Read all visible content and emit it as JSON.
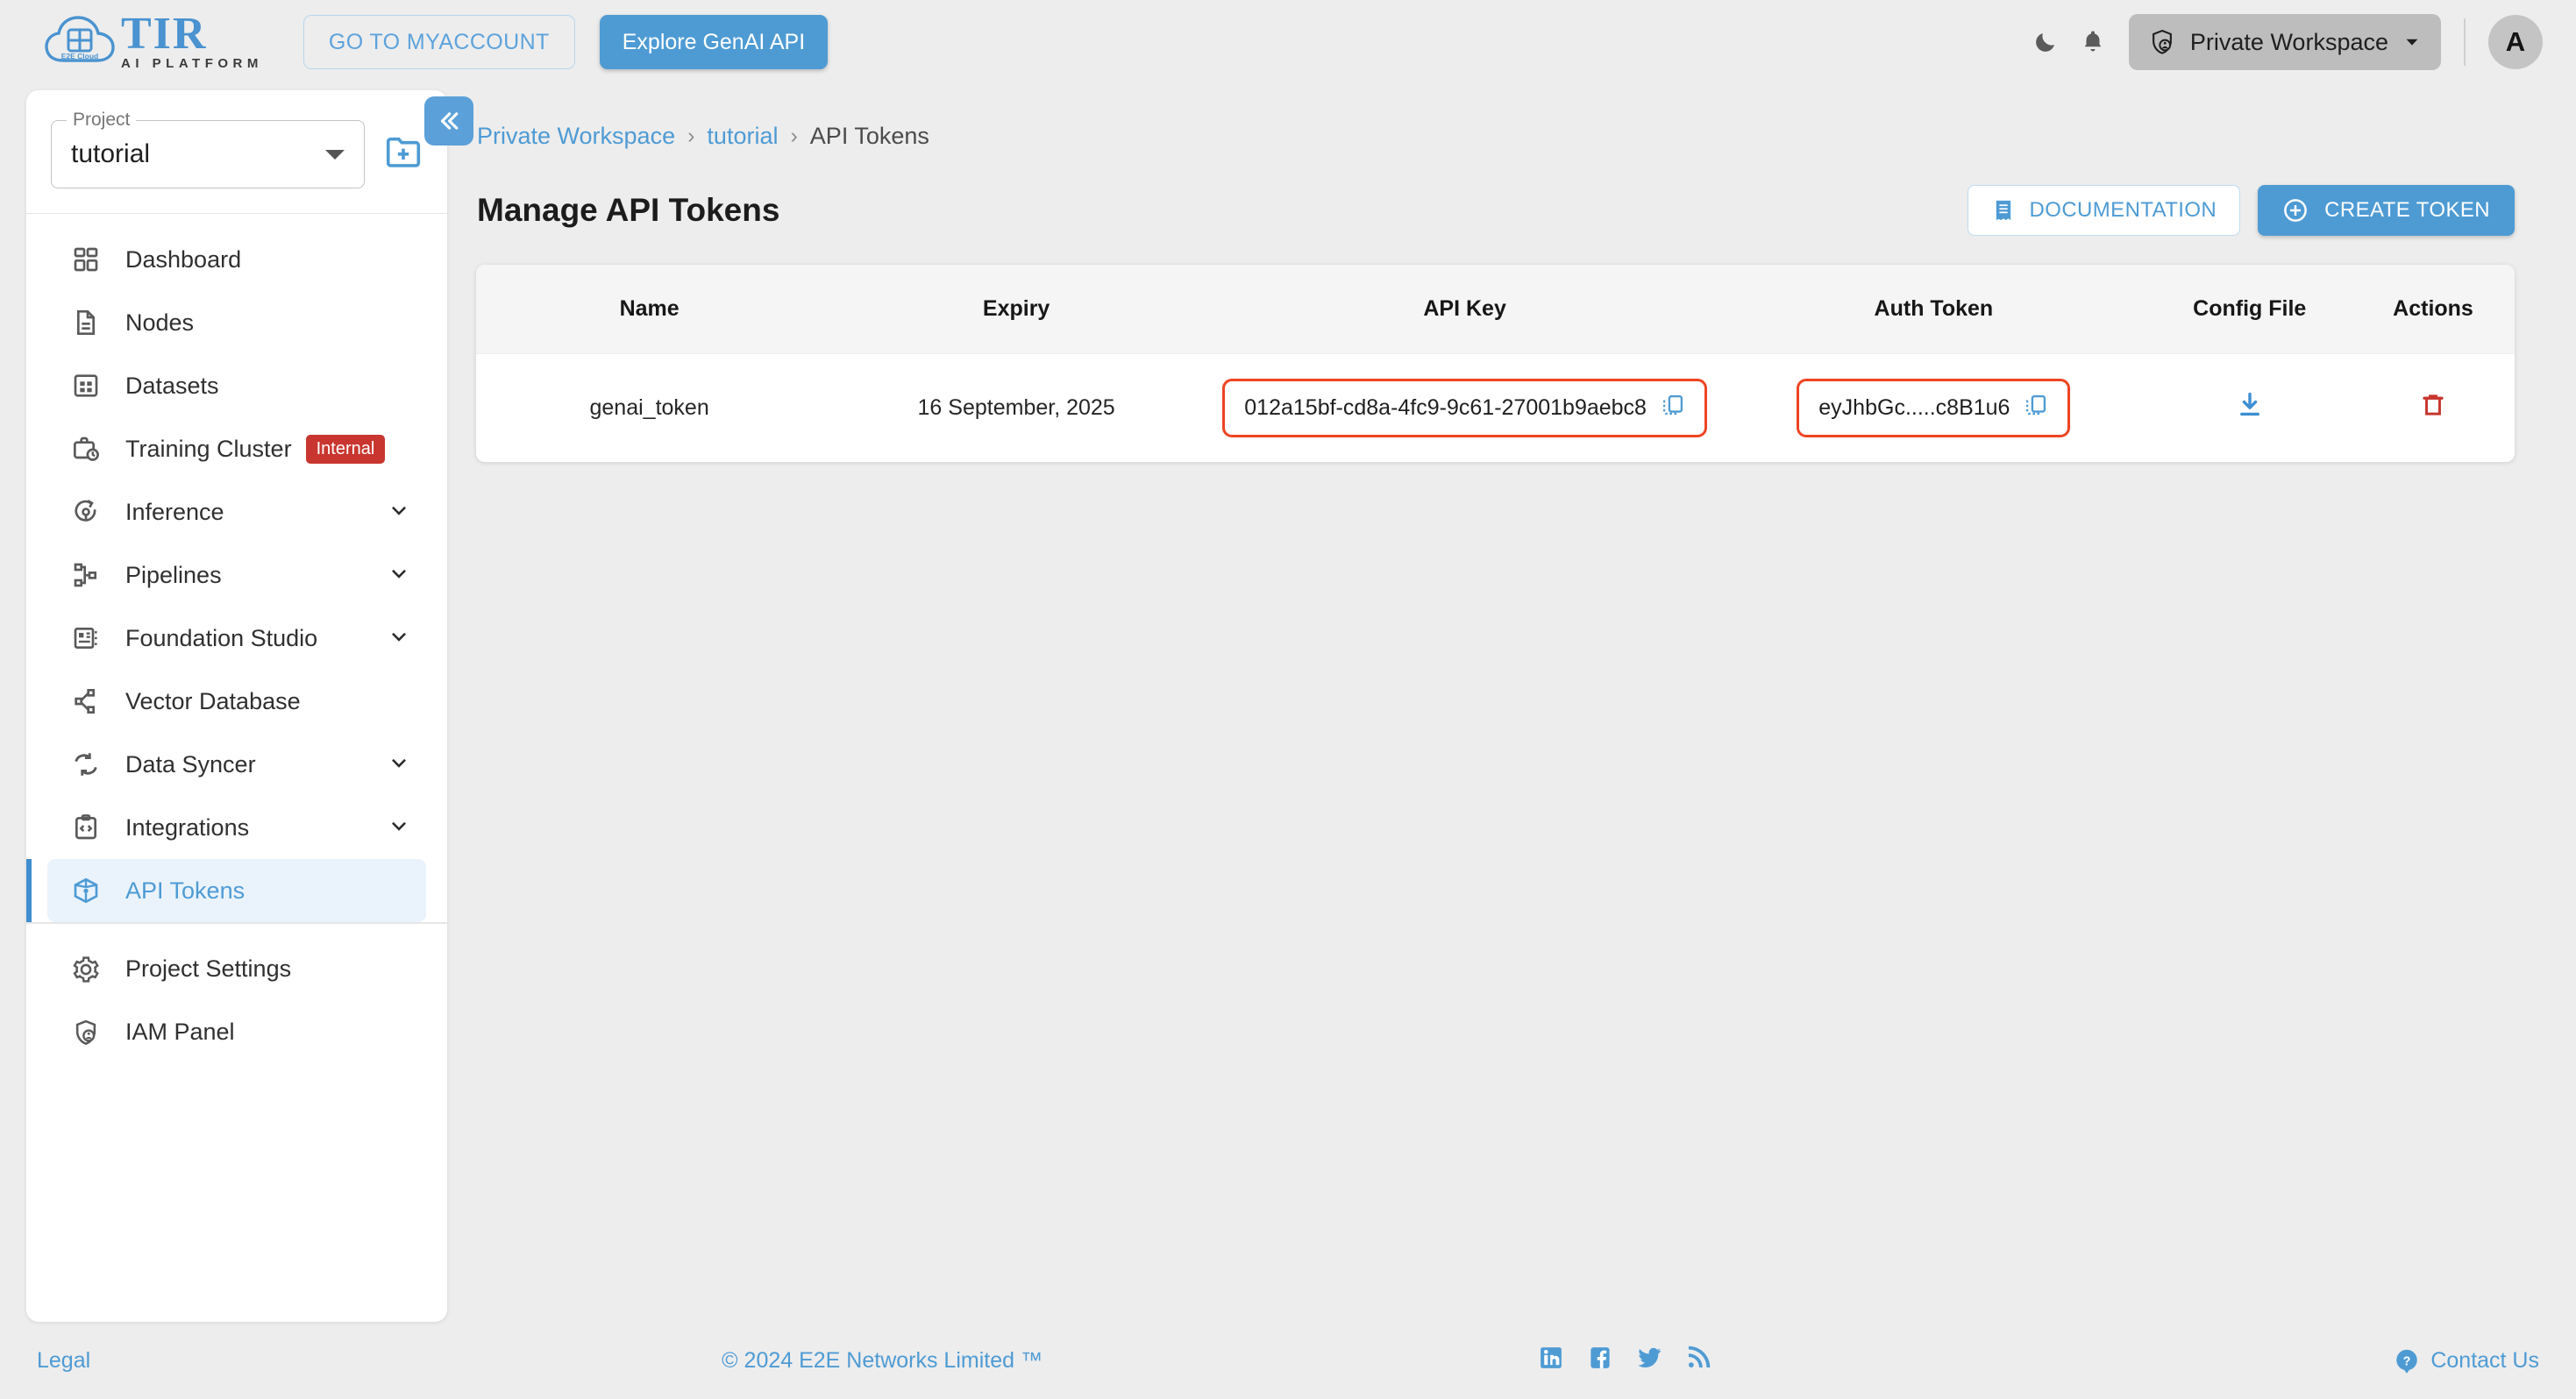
{
  "header": {
    "logo_title": "TIR",
    "logo_subtitle": "AI PLATFORM",
    "logo_cloud_text": "E2E Cloud",
    "myaccount_label": "GO TO MYACCOUNT",
    "genai_label": "Explore GenAI API",
    "dark_mode_icon": "moon-icon",
    "notification_icon": "bell-icon",
    "workspace_icon": "shield-user-icon",
    "workspace_label": "Private Workspace",
    "workspace_caret_icon": "chevron-down-icon",
    "avatar_initial": "A"
  },
  "sidebar": {
    "project_label": "Project",
    "project_value": "tutorial",
    "new_project_icon": "folder-plus-icon",
    "items": [
      {
        "label": "Dashboard",
        "icon": "dashboard-icon",
        "expandable": false,
        "badge": "",
        "active": false
      },
      {
        "label": "Nodes",
        "icon": "document-icon",
        "expandable": false,
        "badge": "",
        "active": false
      },
      {
        "label": "Datasets",
        "icon": "table-icon",
        "expandable": false,
        "badge": "",
        "active": false
      },
      {
        "label": "Training Cluster",
        "icon": "briefcase-clock-icon",
        "expandable": false,
        "badge": "Internal",
        "active": false
      },
      {
        "label": "Inference",
        "icon": "inference-icon",
        "expandable": true,
        "badge": "",
        "active": false
      },
      {
        "label": "Pipelines",
        "icon": "pipeline-icon",
        "expandable": true,
        "badge": "",
        "active": false
      },
      {
        "label": "Foundation Studio",
        "icon": "studio-icon",
        "expandable": true,
        "badge": "",
        "active": false
      },
      {
        "label": "Vector Database",
        "icon": "graph-node-icon",
        "expandable": false,
        "badge": "",
        "active": false
      },
      {
        "label": "Data Syncer",
        "icon": "sync-icon",
        "expandable": true,
        "badge": "",
        "active": false
      },
      {
        "label": "Integrations",
        "icon": "code-clipboard-icon",
        "expandable": true,
        "badge": "",
        "active": false
      },
      {
        "label": "API Tokens",
        "icon": "cube-icon",
        "expandable": false,
        "badge": "",
        "active": true
      }
    ],
    "bottom_items": [
      {
        "label": "Project Settings",
        "icon": "gear-icon"
      },
      {
        "label": "IAM Panel",
        "icon": "shield-user-icon"
      }
    ]
  },
  "main": {
    "collapse_icon": "double-chevron-left-icon",
    "breadcrumb": {
      "item1": "Private Workspace",
      "sep1": "›",
      "item2": "tutorial",
      "sep2": "›",
      "current": "API Tokens"
    },
    "page_title": "Manage API Tokens",
    "documentation_label": "DOCUMENTATION",
    "documentation_icon": "receipt-icon",
    "create_token_label": "CREATE TOKEN",
    "create_token_icon": "plus-circle-icon",
    "table": {
      "columns": [
        "Name",
        "Expiry",
        "API Key",
        "Auth Token",
        "Config File",
        "Actions"
      ],
      "rows": [
        {
          "name": "genai_token",
          "expiry": "16 September, 2025",
          "api_key": "012a15bf-cd8a-4fc9-9c61-27001b9aebc8",
          "api_key_copy_icon": "copy-icon",
          "auth_token": "eyJhbGc.....c8B1u6",
          "auth_token_copy_icon": "copy-icon",
          "config_file_icon": "download-icon",
          "action_icon": "trash-icon"
        }
      ]
    }
  },
  "footer": {
    "legal": "Legal",
    "copyright": "© 2024 E2E Networks Limited ™",
    "social": [
      "linkedin-icon",
      "facebook-icon",
      "twitter-icon",
      "rss-icon"
    ],
    "contact_icon": "question-circle-icon",
    "contact_label": "Contact Us"
  },
  "colors": {
    "accent_blue": "#4e9bd4",
    "highlight_red": "#ef4423",
    "badge_red": "#c8362f",
    "page_bg": "#ededed"
  }
}
